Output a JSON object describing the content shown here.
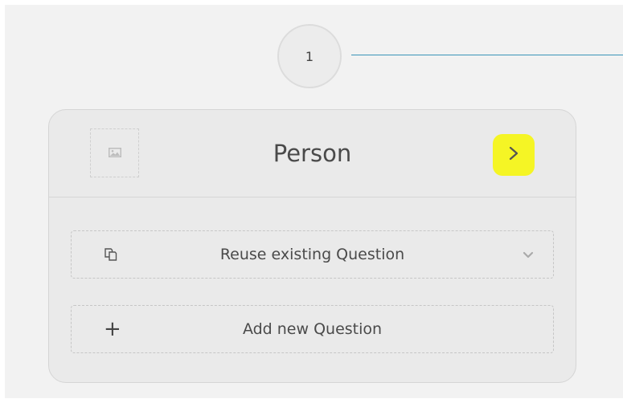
{
  "step": {
    "number": "1",
    "line_color": "#3a94b8"
  },
  "card": {
    "title": "Person",
    "image_placeholder_icon": "image-icon",
    "next_icon": "chevron-right-icon",
    "highlight_color": "#f5f525"
  },
  "actions": {
    "reuse_label": "Reuse existing Question",
    "reuse_icon": "copy-icon",
    "reuse_caret_icon": "chevron-down-icon",
    "add_label": "Add new Question",
    "add_icon": "plus-icon"
  }
}
